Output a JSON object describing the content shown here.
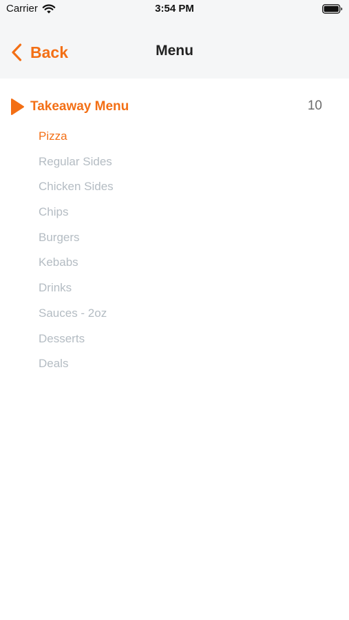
{
  "status_bar": {
    "carrier": "Carrier",
    "time": "3:54 PM",
    "icons": [
      "wifi-icon",
      "battery-icon"
    ]
  },
  "nav": {
    "back_label": "Back",
    "title": "Menu",
    "back_icon": "chevron-left-icon"
  },
  "category": {
    "icon": "play-icon",
    "title": "Takeaway Menu",
    "count": "10"
  },
  "subcategories": [
    {
      "label": "Pizza",
      "active": true
    },
    {
      "label": "Regular Sides",
      "active": false
    },
    {
      "label": "Chicken Sides",
      "active": false
    },
    {
      "label": "Chips",
      "active": false
    },
    {
      "label": "Burgers",
      "active": false
    },
    {
      "label": "Kebabs",
      "active": false
    },
    {
      "label": "Drinks",
      "active": false
    },
    {
      "label": "Sauces - 2oz",
      "active": false
    },
    {
      "label": "Desserts",
      "active": false
    },
    {
      "label": "Deals",
      "active": false
    }
  ],
  "colors": {
    "accent": "#f36f15",
    "inactive_text": "#b4bcc3",
    "bar_background": "#f5f6f7"
  }
}
